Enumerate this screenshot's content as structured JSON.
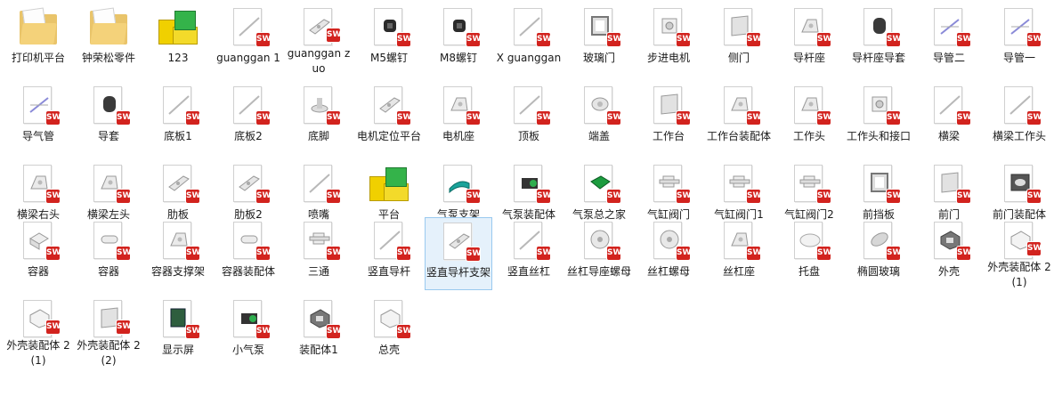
{
  "items": [
    {
      "label": "打印机平台",
      "kind": "folder",
      "icon": "folder-icon"
    },
    {
      "label": "钟荣松零件",
      "kind": "folder",
      "icon": "folder-icon"
    },
    {
      "label": "123",
      "kind": "assembly",
      "icon": "assembly-icon"
    },
    {
      "label": "guanggan 1",
      "kind": "part",
      "icon": "rod-icon"
    },
    {
      "label": "guanggan zuo",
      "kind": "part",
      "icon": "plate-icon"
    },
    {
      "label": "M5螺钉",
      "kind": "part",
      "icon": "screw-icon"
    },
    {
      "label": "M8螺钉",
      "kind": "part",
      "icon": "screw-icon"
    },
    {
      "label": "X guanggan",
      "kind": "part",
      "icon": "rod-icon"
    },
    {
      "label": "玻璃门",
      "kind": "part",
      "icon": "frame-icon"
    },
    {
      "label": "步进电机",
      "kind": "part",
      "icon": "motor-icon"
    },
    {
      "label": "侧门",
      "kind": "part",
      "icon": "panel-icon"
    },
    {
      "label": "导杆座",
      "kind": "part",
      "icon": "bracket-icon"
    },
    {
      "label": "导杆座导套",
      "kind": "part",
      "icon": "sleeve-icon"
    },
    {
      "label": "导管二",
      "kind": "part",
      "icon": "tube-icon"
    },
    {
      "label": "导管一",
      "kind": "part",
      "icon": "tube-icon"
    },
    {
      "label": "导气管",
      "kind": "part",
      "icon": "tube-icon"
    },
    {
      "label": "导套",
      "kind": "part",
      "icon": "sleeve-icon"
    },
    {
      "label": "底板1",
      "kind": "part",
      "icon": "rod-icon"
    },
    {
      "label": "底板2",
      "kind": "part",
      "icon": "rod-icon"
    },
    {
      "label": "底脚",
      "kind": "part",
      "icon": "foot-icon"
    },
    {
      "label": "电机定位平台",
      "kind": "part",
      "icon": "plate-icon"
    },
    {
      "label": "电机座",
      "kind": "part",
      "icon": "bracket-icon"
    },
    {
      "label": "顶板",
      "kind": "part",
      "icon": "rod-icon"
    },
    {
      "label": "端盖",
      "kind": "part",
      "icon": "cap-icon"
    },
    {
      "label": "工作台",
      "kind": "part",
      "icon": "panel-icon"
    },
    {
      "label": "工作台装配体",
      "kind": "part",
      "icon": "bracket-icon"
    },
    {
      "label": "工作头",
      "kind": "part",
      "icon": "bracket-icon"
    },
    {
      "label": "工作头和接口",
      "kind": "part",
      "icon": "motor-icon"
    },
    {
      "label": "横梁",
      "kind": "part",
      "icon": "rod-icon"
    },
    {
      "label": "横梁工作头",
      "kind": "part",
      "icon": "rod-icon"
    },
    {
      "label": "横梁右头",
      "kind": "part",
      "icon": "bracket-icon"
    },
    {
      "label": "横梁左头",
      "kind": "part",
      "icon": "bracket-icon"
    },
    {
      "label": "肋板",
      "kind": "part",
      "icon": "plate-icon"
    },
    {
      "label": "肋板2",
      "kind": "part",
      "icon": "plate-icon"
    },
    {
      "label": "喷嘴",
      "kind": "part",
      "icon": "rod-icon"
    },
    {
      "label": "平台",
      "kind": "assembly",
      "icon": "assembly-icon"
    },
    {
      "label": "气泵支架",
      "kind": "part",
      "icon": "bracket-teal-icon"
    },
    {
      "label": "气泵装配体",
      "kind": "part",
      "icon": "pump-icon"
    },
    {
      "label": "气泵总之家",
      "kind": "part",
      "icon": "bracket-green-icon"
    },
    {
      "label": "气缸阀门",
      "kind": "part",
      "icon": "valve-icon"
    },
    {
      "label": "气缸阀门1",
      "kind": "part",
      "icon": "valve-icon"
    },
    {
      "label": "气缸阀门2",
      "kind": "part",
      "icon": "valve-icon"
    },
    {
      "label": "前挡板",
      "kind": "part",
      "icon": "frame-icon"
    },
    {
      "label": "前门",
      "kind": "part",
      "icon": "panel-icon"
    },
    {
      "label": "前门装配体",
      "kind": "part",
      "icon": "frame-dark-icon"
    },
    {
      "label": "容器",
      "kind": "part",
      "icon": "box-icon"
    },
    {
      "label": "容器",
      "kind": "part",
      "icon": "cylinder-icon"
    },
    {
      "label": "容器支撑架",
      "kind": "part",
      "icon": "bracket-icon"
    },
    {
      "label": "容器装配体",
      "kind": "part",
      "icon": "cylinder-icon"
    },
    {
      "label": "三通",
      "kind": "part",
      "icon": "valve-icon"
    },
    {
      "label": "竖直导杆",
      "kind": "part",
      "icon": "rod-icon"
    },
    {
      "label": "竖直导杆支架",
      "kind": "part",
      "icon": "plate-icon",
      "selected": true
    },
    {
      "label": "竖直丝杠",
      "kind": "part",
      "icon": "rod-icon"
    },
    {
      "label": "丝杠导座螺母",
      "kind": "part",
      "icon": "flange-icon"
    },
    {
      "label": "丝杠螺母",
      "kind": "part",
      "icon": "flange-icon"
    },
    {
      "label": "丝杠座",
      "kind": "part",
      "icon": "bracket-icon"
    },
    {
      "label": "托盘",
      "kind": "part",
      "icon": "disc-icon"
    },
    {
      "label": "椭圆玻璃",
      "kind": "part",
      "icon": "ellipse-icon"
    },
    {
      "label": "外壳",
      "kind": "part",
      "icon": "shell-dark-icon"
    },
    {
      "label": "外壳装配体 2 (1)",
      "kind": "part",
      "icon": "shell-icon"
    },
    {
      "label": "外壳装配体 2 (1)",
      "kind": "part",
      "icon": "shell-icon"
    },
    {
      "label": "外壳装配体 2 (2)",
      "kind": "part",
      "icon": "panel-icon"
    },
    {
      "label": "显示屏",
      "kind": "part",
      "icon": "screen-icon"
    },
    {
      "label": "小气泵",
      "kind": "part",
      "icon": "pump-icon"
    },
    {
      "label": "装配体1",
      "kind": "part",
      "icon": "shell-dark-icon"
    },
    {
      "label": "总壳",
      "kind": "part",
      "icon": "shell-icon"
    }
  ],
  "badge": {
    "text": "SW",
    "color": "#d2231e"
  }
}
